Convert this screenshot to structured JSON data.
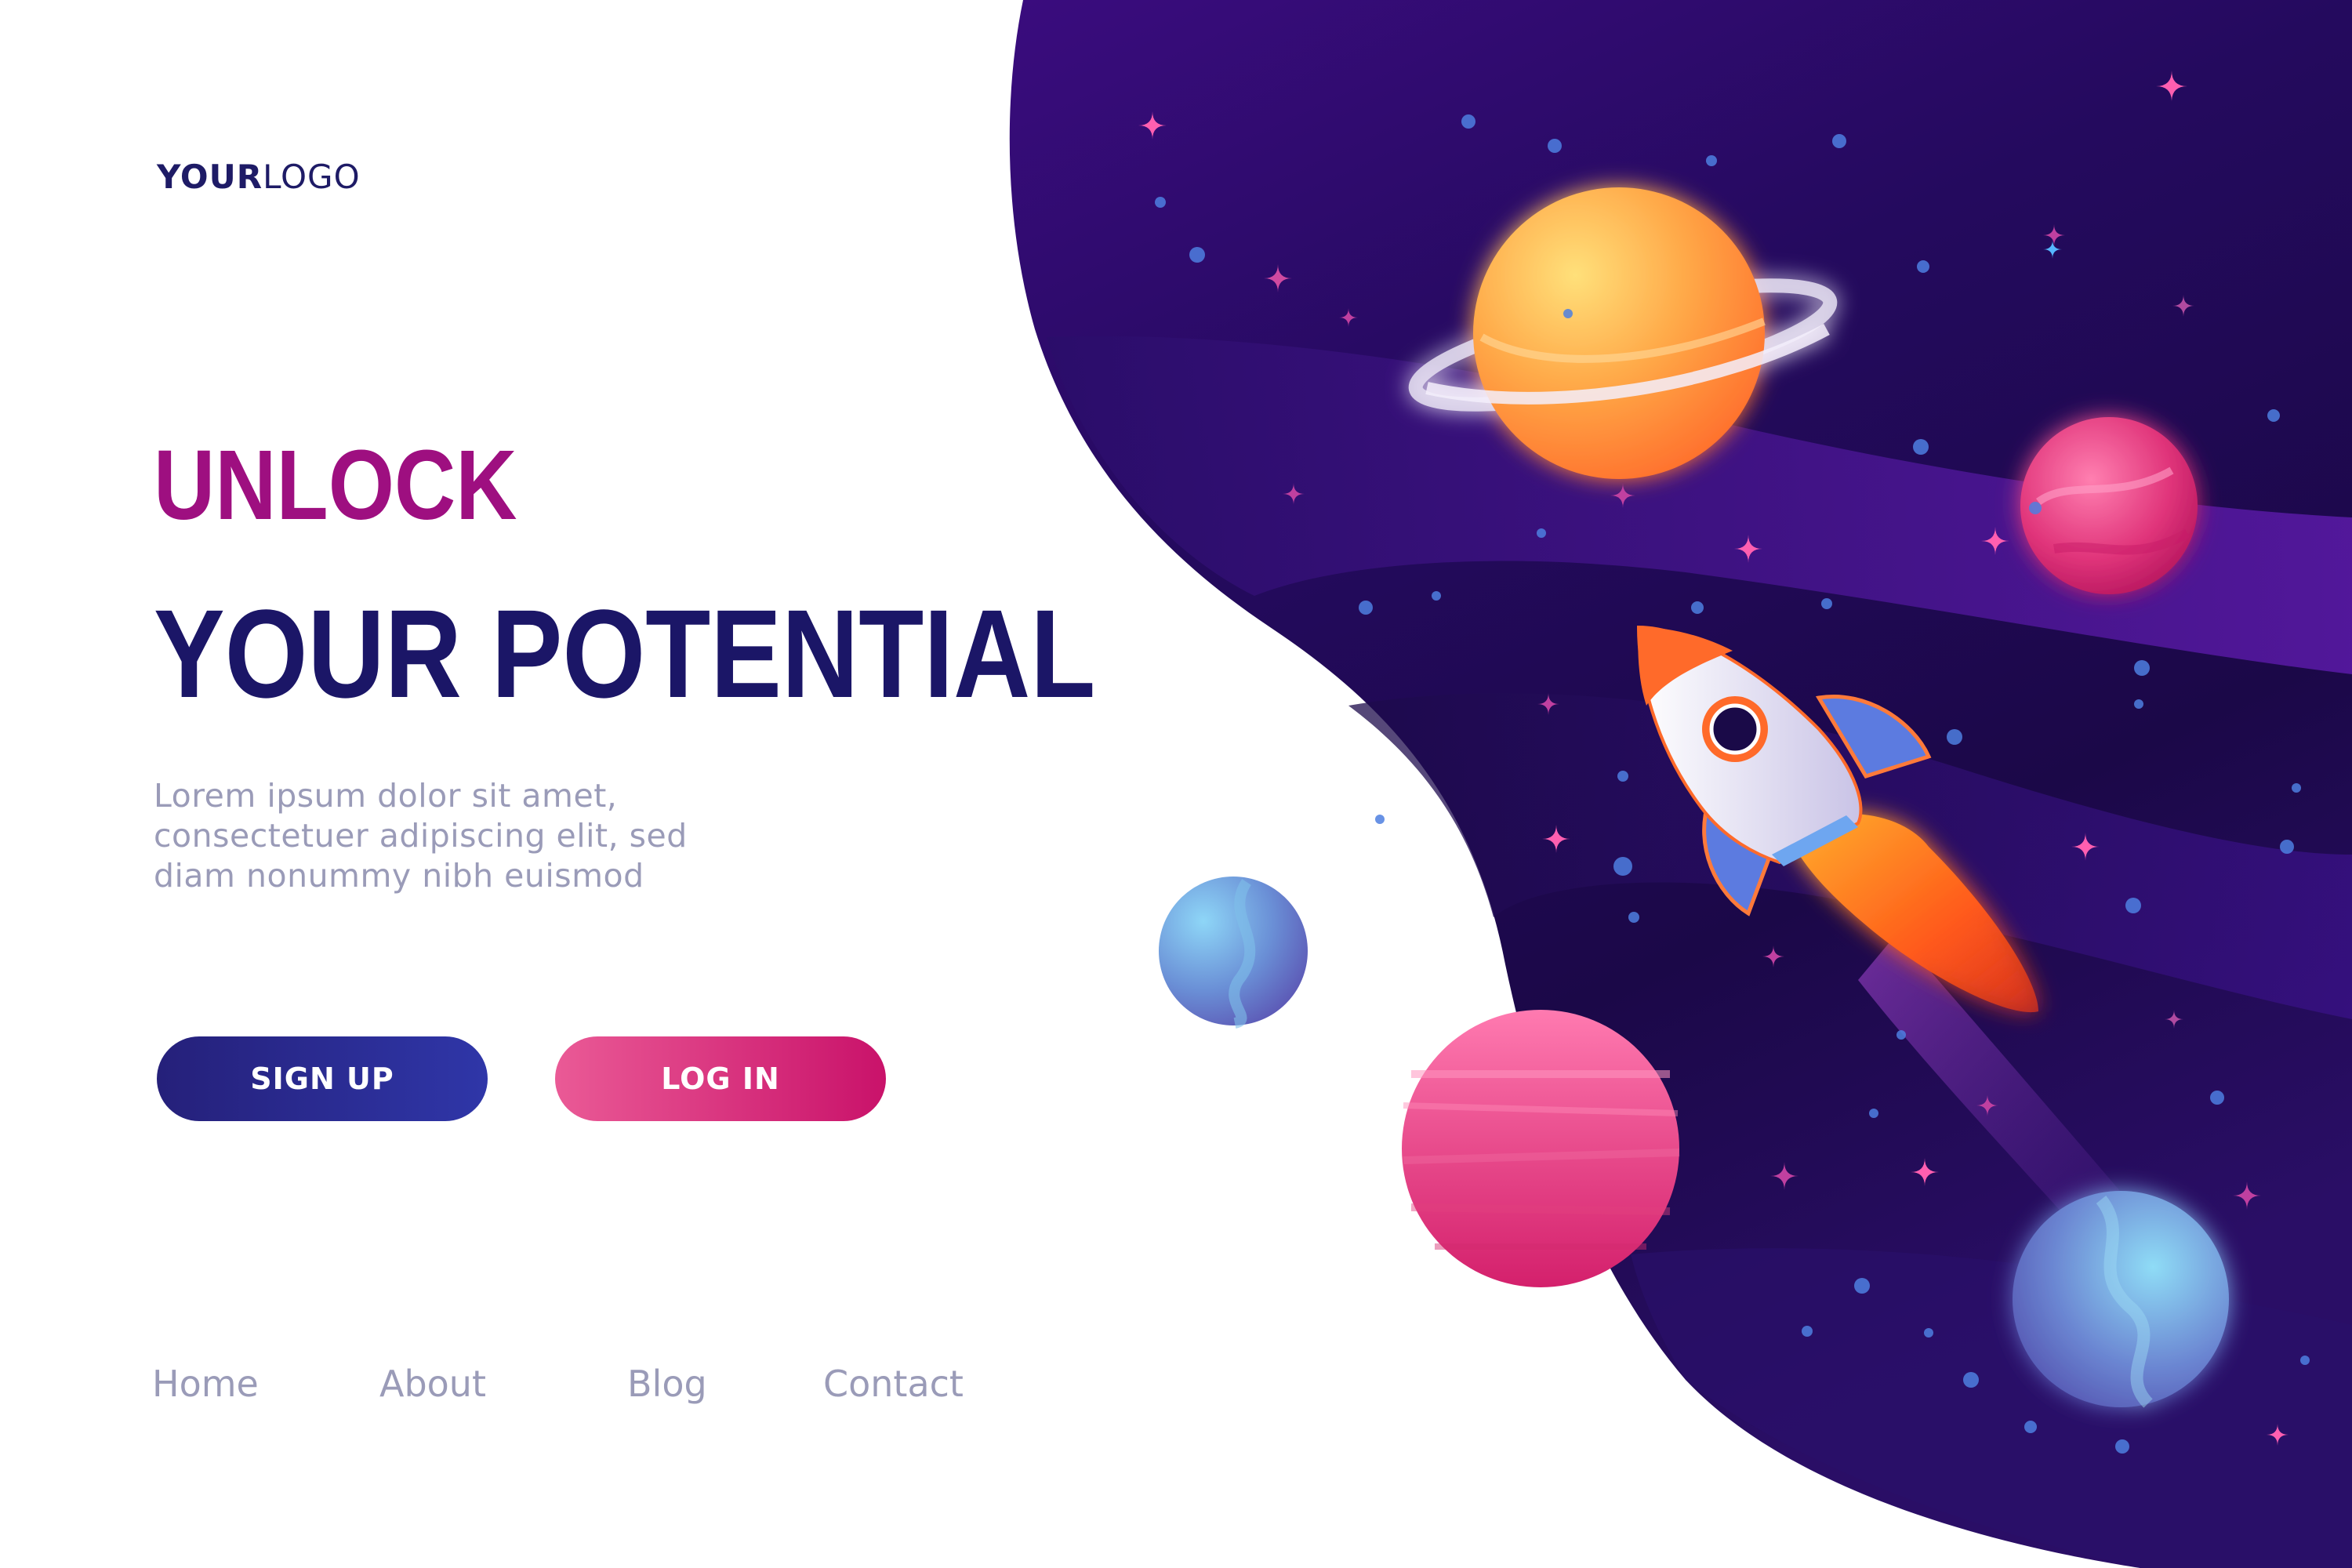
{
  "logo": {
    "bold": "YOUR",
    "light": "LOGO"
  },
  "hero": {
    "line1": "UNLOCK",
    "line2": "YOUR POTENTIAL",
    "body": [
      "Lorem ipsum dolor sit amet,",
      "consectetuer adipiscing elit, sed",
      "diam nonummy nibh euismod"
    ]
  },
  "buttons": {
    "signup": "SIGN UP",
    "login": "LOG IN"
  },
  "nav": {
    "items": [
      "Home",
      "About",
      "Blog",
      "Contact"
    ]
  },
  "colors": {
    "headline_accent": "#9e0f80",
    "headline_primary": "#1b1667",
    "body_text": "#9a9bb8",
    "signup_button": "#2a2a8f",
    "login_button": "#d8287a",
    "space_dark": "#1f0a4f",
    "space_purple": "#5a1a9e"
  },
  "icons": {
    "planets": [
      "ringed-planet-icon",
      "pink-planet-icon",
      "blue-planet-icon",
      "striped-pink-planet-icon",
      "blue-planet-bottom-icon"
    ],
    "rocket": "rocket-icon",
    "stars": "sparkle-star-icon"
  }
}
